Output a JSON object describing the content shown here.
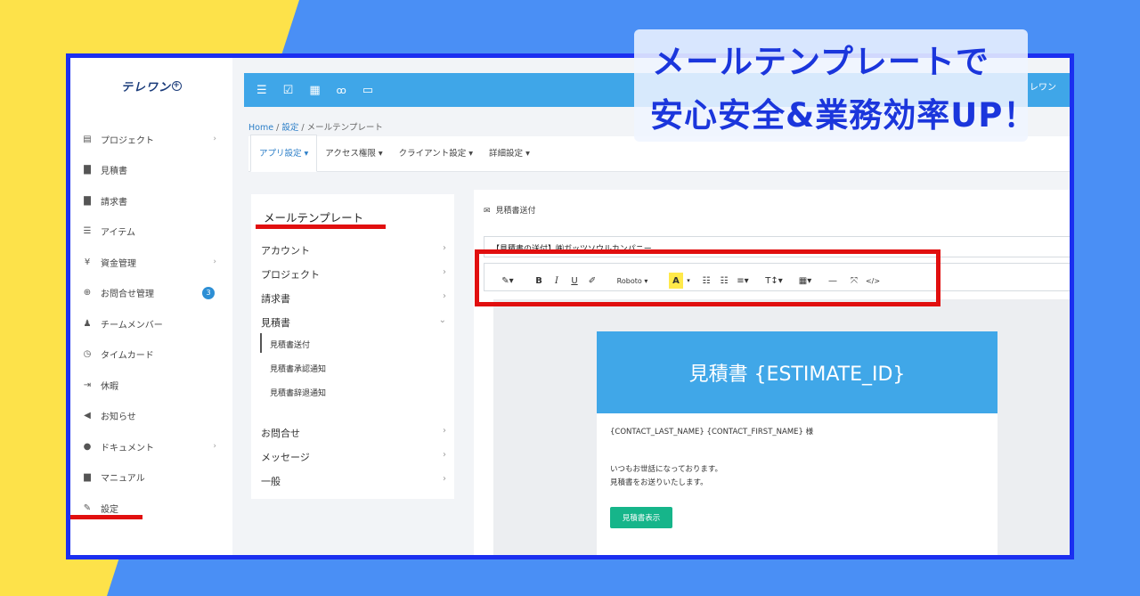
{
  "colors": {
    "background_blue": "#4a8ff5",
    "background_yellow": "#fde24a",
    "frame_border": "#1b2ff0",
    "topbar": "#3fa6e8",
    "highlight_red": "#e10f0f",
    "overlay_text": "#1b36dc",
    "button_green": "#16b58a"
  },
  "overlay": {
    "line1": "メールテンプレートで",
    "line2": "安心安全&業務効率UP！"
  },
  "logo": {
    "text": "テレワン",
    "mark": "+"
  },
  "topbar": {
    "icons": [
      "menu-icon",
      "checkbox-icon",
      "calendar-icon",
      "users-icon",
      "monitor-icon"
    ],
    "user_fragment": "レワン"
  },
  "sidebar": {
    "items": [
      {
        "label": "プロジェクト",
        "icon": "▤",
        "chevron": true
      },
      {
        "label": "見積書",
        "icon": "▇"
      },
      {
        "label": "請求書",
        "icon": "▇"
      },
      {
        "label": "アイテム",
        "icon": "☰"
      },
      {
        "label": "資金管理",
        "icon": "¥",
        "chevron": true
      },
      {
        "label": "お問合せ管理",
        "icon": "⊕",
        "badge": "3"
      },
      {
        "label": "チームメンバー",
        "icon": "♟"
      },
      {
        "label": "タイムカード",
        "icon": "◷"
      },
      {
        "label": "休暇",
        "icon": "⇥"
      },
      {
        "label": "お知らせ",
        "icon": "◀"
      },
      {
        "label": "ドキュメント",
        "icon": "●",
        "chevron": true
      },
      {
        "label": "マニュアル",
        "icon": "▆"
      },
      {
        "label": "設定",
        "icon": "✎"
      }
    ]
  },
  "breadcrumb": {
    "home": "Home",
    "sep": "/",
    "settings": "設定",
    "current": "メールテンプレート"
  },
  "tabs": [
    "アプリ設定 ▾",
    "アクセス権限 ▾",
    "クライアント設定 ▾",
    "詳細設定 ▾"
  ],
  "left_panel": {
    "title": "メールテンプレート",
    "items": [
      "アカウント",
      "プロジェクト",
      "請求書",
      "見積書"
    ],
    "sub_items": [
      "見積書送付",
      "見積書承認通知",
      "見積書辞退通知"
    ],
    "items_after": [
      "お問合せ",
      "メッセージ",
      "一般"
    ]
  },
  "right_panel": {
    "heading": "見積書送付",
    "subject_value": "【見積書の送付】㈱ガッツソウルカンパニー",
    "toolbar": {
      "magic": "✎▾",
      "bold": "B",
      "italic": "I",
      "underline": "U",
      "eraser": "✐",
      "font": "Roboto ▾",
      "color": "A",
      "color_arrow": "▾",
      "ul": "☷",
      "ol": "☷",
      "align": "≡▾",
      "height": "T↕▾",
      "table": "▦▾",
      "hr": "—",
      "fullscreen": "⤧",
      "code": "</>"
    }
  },
  "email": {
    "header": "見積書 {ESTIMATE_ID}",
    "salutation": "{CONTACT_LAST_NAME} {CONTACT_FIRST_NAME} 様",
    "line1": "いつもお世話になっております。",
    "line2": "見積書をお送りいたします。",
    "button": "見積書表示"
  }
}
